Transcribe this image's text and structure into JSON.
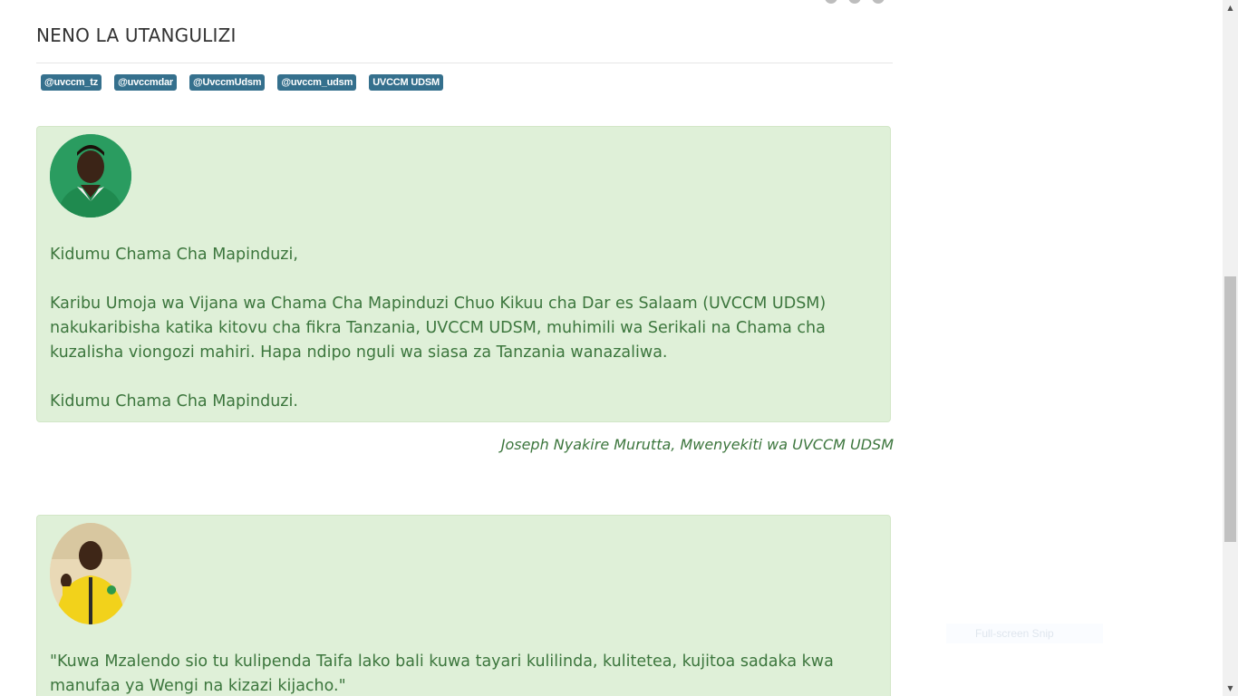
{
  "heading": "NENO LA UTANGULIZI",
  "tags": [
    "@uvccm_tz",
    "@uvccmdar",
    "@UvccmUdsm",
    "@uvccm_udsm",
    "UVCCM UDSM"
  ],
  "message1": {
    "greeting": "Kidumu Chama Cha Mapinduzi,",
    "body": "Karibu Umoja wa Vijana wa Chama Cha Mapinduzi Chuo Kikuu cha Dar es Salaam (UVCCM UDSM) nakukaribisha katika kitovu cha fikra Tanzania, UVCCM UDSM, muhimili wa Serikali na Chama cha kuzalisha viongozi mahiri. Hapa ndipo nguli wa siasa za Tanzania wanazaliwa.",
    "closing": "Kidumu Chama Cha Mapinduzi.",
    "signature": "Joseph Nyakire Murutta, Mwenyekiti wa UVCCM UDSM"
  },
  "message2": {
    "quote": "\"Kuwa Mzalendo sio tu kulipenda Taifa lako bali kuwa tayari kulilinda, kulitetea, kujitoa sadaka kwa manufaa ya Wengi na kizazi kijacho.\""
  },
  "overlay": {
    "snip_label": "Full-screen Snip"
  },
  "colors": {
    "tag_bg": "#35708d",
    "card_bg": "#dff0d8",
    "card_text": "#3c763d"
  }
}
